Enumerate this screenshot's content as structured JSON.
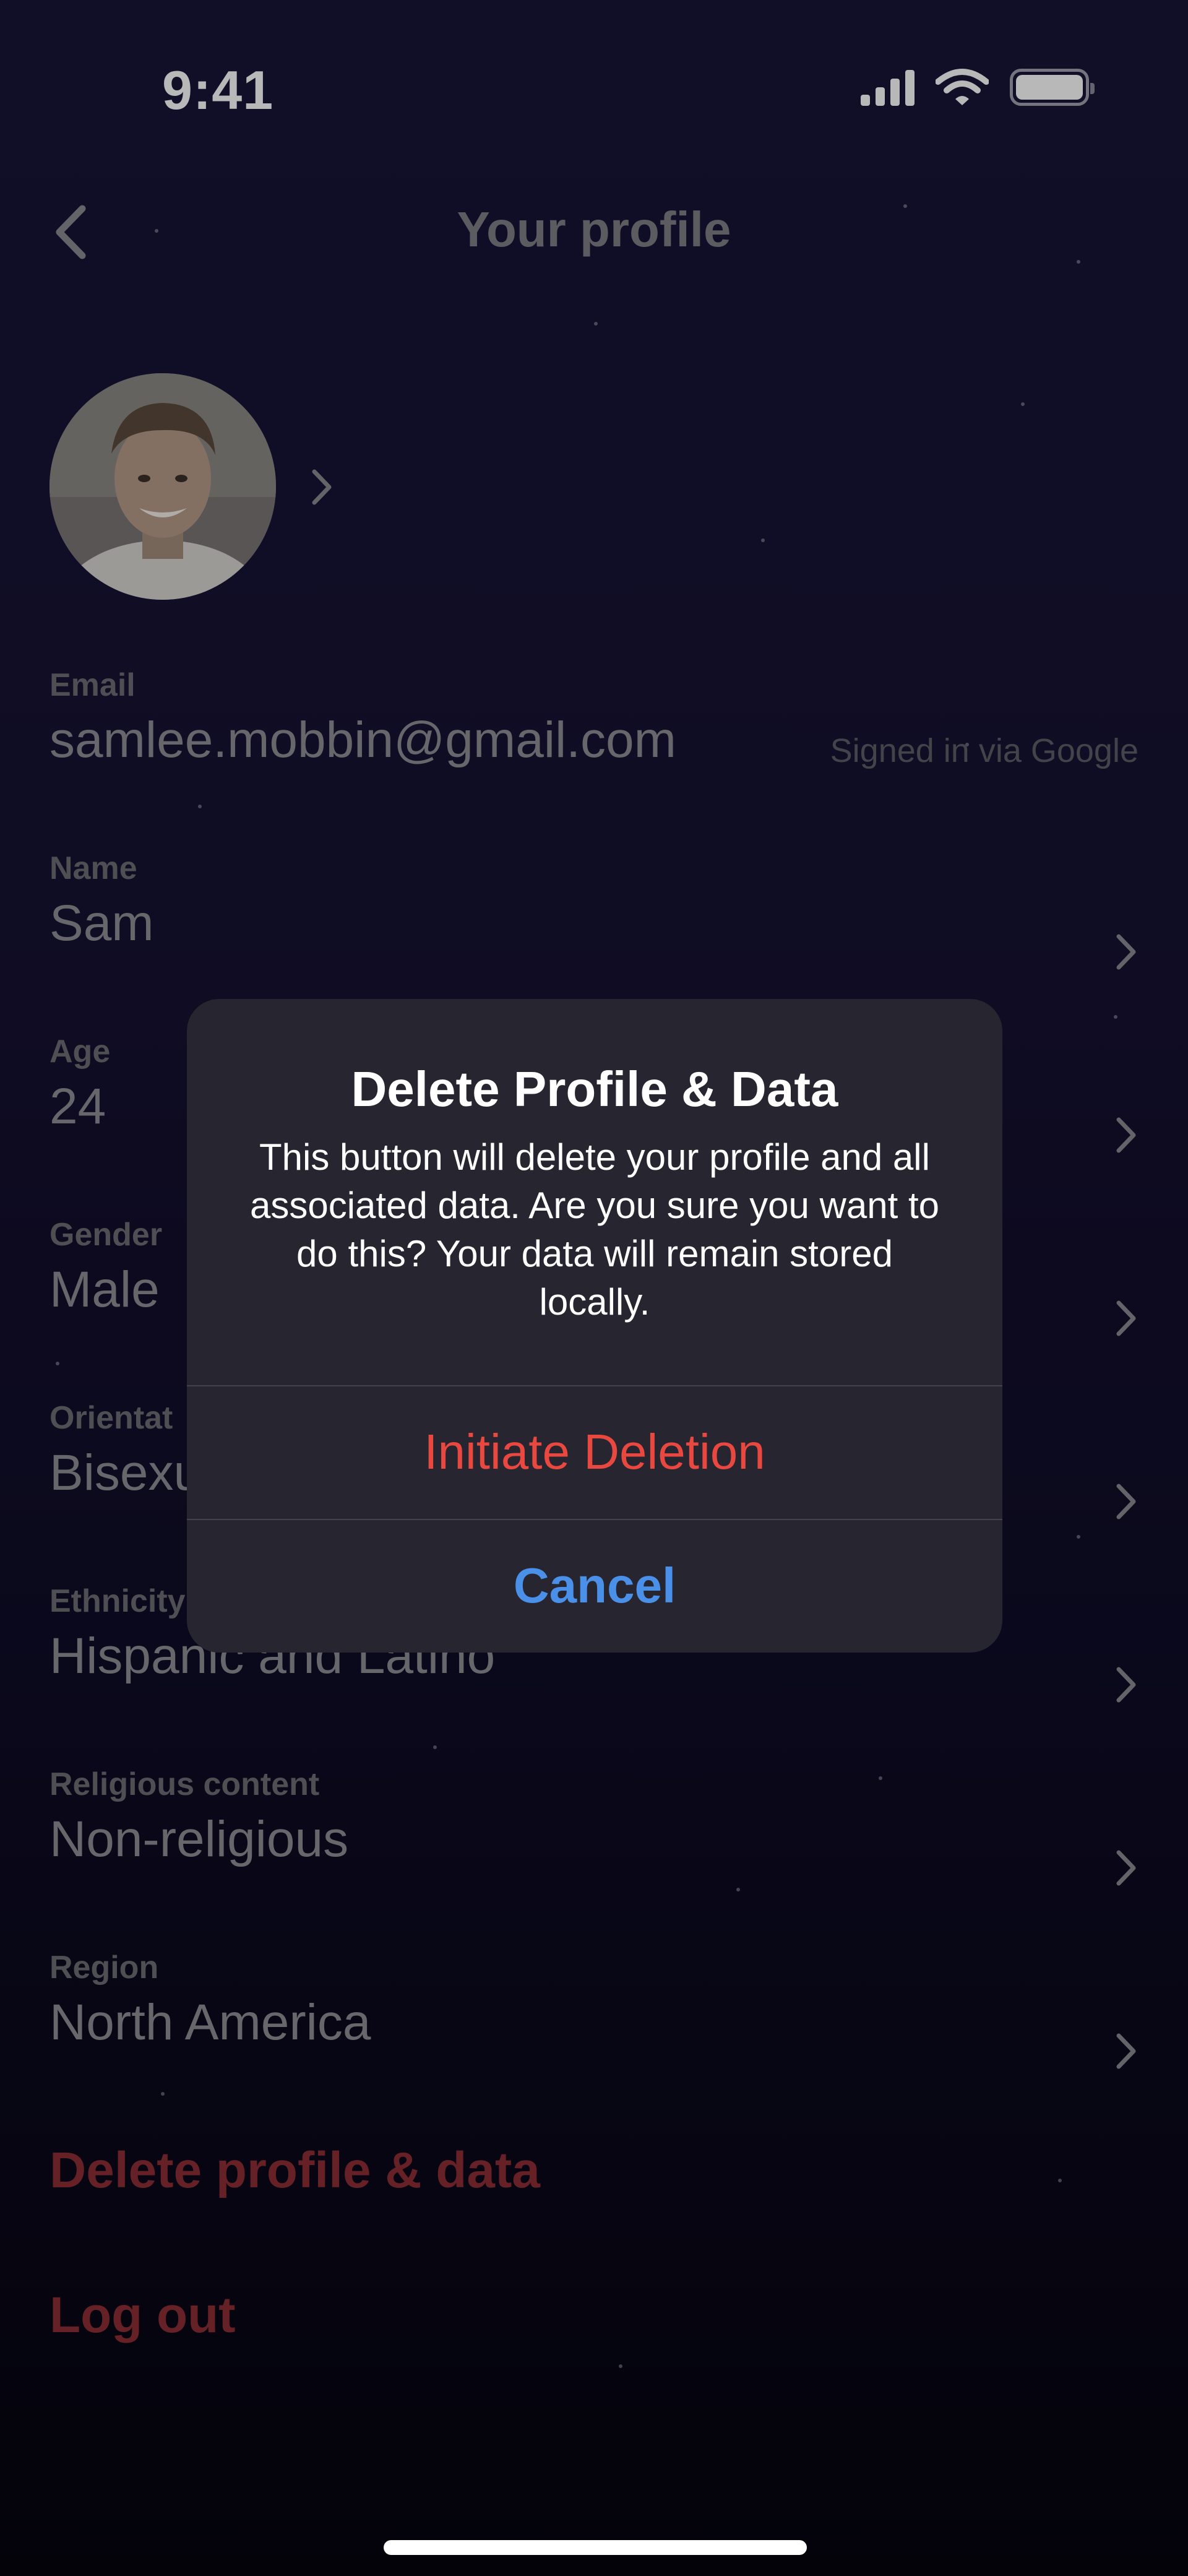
{
  "status_bar": {
    "time": "9:41",
    "icons": [
      "cellular-signal-icon",
      "wifi-icon",
      "battery-icon"
    ]
  },
  "nav": {
    "back_icon": "chevron-left-icon",
    "title": "Your profile"
  },
  "profile": {
    "avatar_icon": "avatar-photo",
    "chevron_icon": "chevron-right-icon"
  },
  "fields": [
    {
      "label": "Email",
      "value": "samlee.mobbin@gmail.com",
      "note": "Signed in via Google"
    },
    {
      "label": "Name",
      "value": "Sam"
    },
    {
      "label": "Age",
      "value": "24"
    },
    {
      "label": "Gender",
      "value": "Male"
    },
    {
      "label": "Orientat",
      "value": "Bisexu"
    },
    {
      "label": "Ethnicity",
      "value": "Hispanic and Latino"
    },
    {
      "label": "Religious content",
      "value": "Non-religious"
    },
    {
      "label": "Region",
      "value": "North America"
    }
  ],
  "actions": {
    "delete_profile": "Delete profile & data",
    "log_out": "Log out"
  },
  "dialog": {
    "title": "Delete Profile & Data",
    "message": "This button will delete your profile and all associated data. Are you sure you want to do this? Your data will remain stored locally.",
    "confirm_label": "Initiate Deletion",
    "cancel_label": "Cancel"
  },
  "colors": {
    "danger": "#e8483f",
    "link": "#4a90e8",
    "dialog_bg": "#262530"
  }
}
